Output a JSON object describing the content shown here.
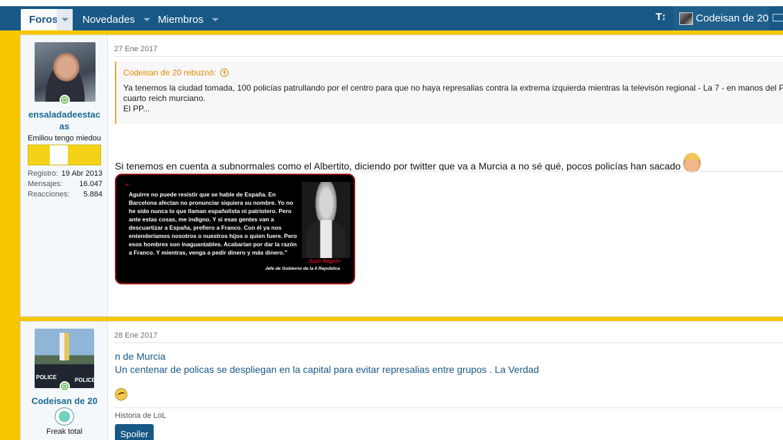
{
  "nav": {
    "tabs": [
      {
        "label": "Foros",
        "active": true
      },
      {
        "label": "Novedades"
      },
      {
        "label": "Miembros"
      }
    ],
    "text_size_icon": "T↕",
    "user_label": "Codeisan de 20"
  },
  "post1": {
    "user": {
      "name": "ensaladadeestacas",
      "name_line1": "ensaladadeestac",
      "name_line2": "as",
      "title": "Emiliou tengo miedou",
      "stats": [
        {
          "label": "Registro:",
          "value": "19 Abr 2013"
        },
        {
          "label": "Mensajes:",
          "value": "16.047"
        },
        {
          "label": "Reacciones:",
          "value": "5.884"
        }
      ]
    },
    "date": "27 Ene 2017",
    "quote": {
      "author": "Codeisan de 20 rebuznó:",
      "lines": [
        "Ya tenemos la ciudad tomada, 100 policías patrullando por el centro para que no haya represalias contra la extrema izquierda mientras la televisón regional - La 7 - en manos del PP alim",
        "cuarto reich murciano.",
        "El PP..."
      ]
    },
    "message": "Si tenemos en cuenta a subnormales como el Albertito, diciendo por twitter que va a Murcia a no sé qué, pocos policías han sacado",
    "image": {
      "quote_mark": "\"",
      "text": "Aguirre no puede resistir que se hable de España. En Barcelona afectan no pronunciar siquiera su nombre. Yo no he sido nunca lo que llaman españolista ni patriotero. Pero ante estas cosas, me indigno. Y si esas gentes van a descuartizar a España, prefiero a Franco. Con él ya nos entenderíamos nosotros o nuestros hijos o quien fuere. Pero esos hombres son inaguantables. Acabarían por dar la razón a Franco.  Y mientras, venga a pedir dinero y más dinero.\"",
      "author": "Juan Negrín",
      "role": "Jefe de Gobierno  de la II República"
    }
  },
  "post2": {
    "user": {
      "name": "Codeisan de 20",
      "title": "Freak total"
    },
    "date": "28 Ene 2017",
    "links": [
      "n de Murcia",
      "Un centenar de policas se despliegan en la capital para evitar represalias entre grupos . La Verdad"
    ],
    "signature": "Historia de LoL",
    "spoiler_label": "Spoiler"
  },
  "colors": {
    "nav_bg": "#185886",
    "accent_gold": "#f6c700",
    "link": "#185886",
    "quote_accent": "#e08a00"
  }
}
